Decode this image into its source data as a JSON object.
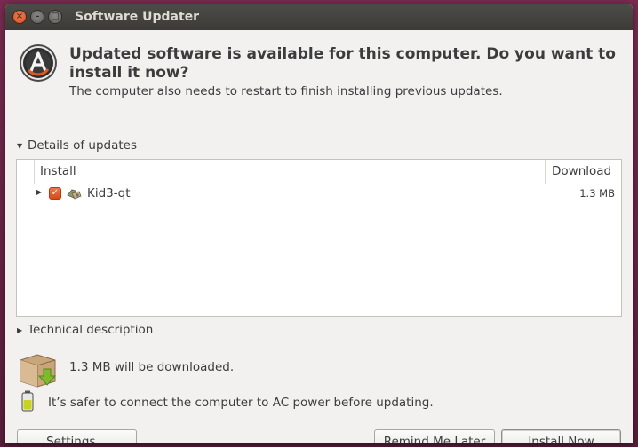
{
  "window": {
    "title": "Software Updater",
    "buttons": {
      "close": "×",
      "minimize": "–",
      "maximize": "□"
    }
  },
  "header": {
    "headline": "Updated software is available for this computer. Do you want to install it now?",
    "subline": "The computer also needs to restart to finish installing previous updates."
  },
  "details": {
    "label": "Details of updates",
    "columns": {
      "install": "Install",
      "download": "Download"
    },
    "rows": [
      {
        "name": "Kid3-qt",
        "size": "1.3 MB",
        "checked": true
      }
    ]
  },
  "technical": {
    "label": "Technical description"
  },
  "info": {
    "download_text": "1.3 MB will be downloaded.",
    "power_text": "It’s safer to connect the computer to AC power before updating."
  },
  "buttons": {
    "settings": "Settings…",
    "remind": "Remind Me Later",
    "install": "Install Now"
  },
  "colors": {
    "accent": "#dd4814",
    "titlebar": "#3c3b37",
    "window_bg": "#f2f1f0"
  },
  "icons": [
    "software-updater-icon",
    "package-icon",
    "download-box-icon",
    "battery-icon"
  ]
}
